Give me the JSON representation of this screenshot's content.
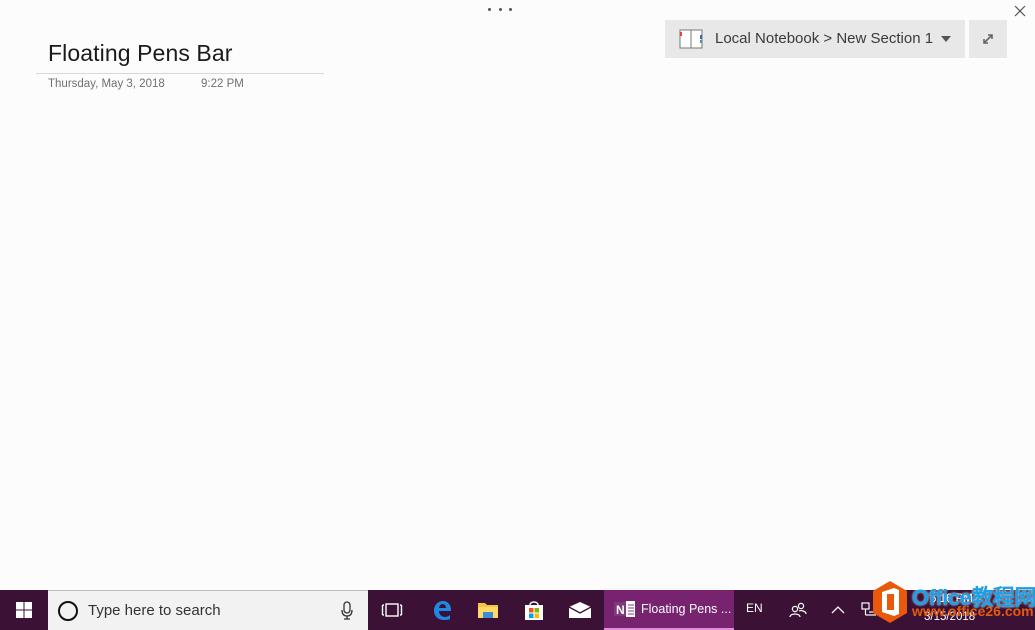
{
  "window": {
    "more_options_icon": "ellipsis-icon",
    "close_icon": "close-icon"
  },
  "page": {
    "title": "Floating Pens Bar",
    "date": "Thursday, May 3, 2018",
    "time": "9:22 PM"
  },
  "notebook_picker": {
    "label": "Local Notebook > New Section 1",
    "icon": "notebook-icon",
    "dropdown_icon": "caret-down-icon"
  },
  "expand_button": {
    "icon": "expand-icon"
  },
  "taskbar": {
    "search_placeholder": "Type here to search",
    "apps": [
      {
        "name": "task-view",
        "icon": "task-view-icon"
      },
      {
        "name": "edge",
        "icon": "edge-icon"
      },
      {
        "name": "file-explorer",
        "icon": "folder-icon"
      },
      {
        "name": "store",
        "icon": "store-icon"
      },
      {
        "name": "mail",
        "icon": "mail-icon"
      }
    ],
    "active_app_label": "Floating Pens ...",
    "language": "EN",
    "clock_time": "6:16 PM",
    "clock_date": "3/15/2018"
  },
  "watermark": {
    "title": "Office教程网",
    "url": "www.office26.com"
  },
  "colors": {
    "taskbar": "#3b1235",
    "active_app": "#78236f",
    "picker_bg": "#e8e8e8",
    "watermark_blue": "#1aa0e6",
    "watermark_orange": "#e8590c"
  }
}
